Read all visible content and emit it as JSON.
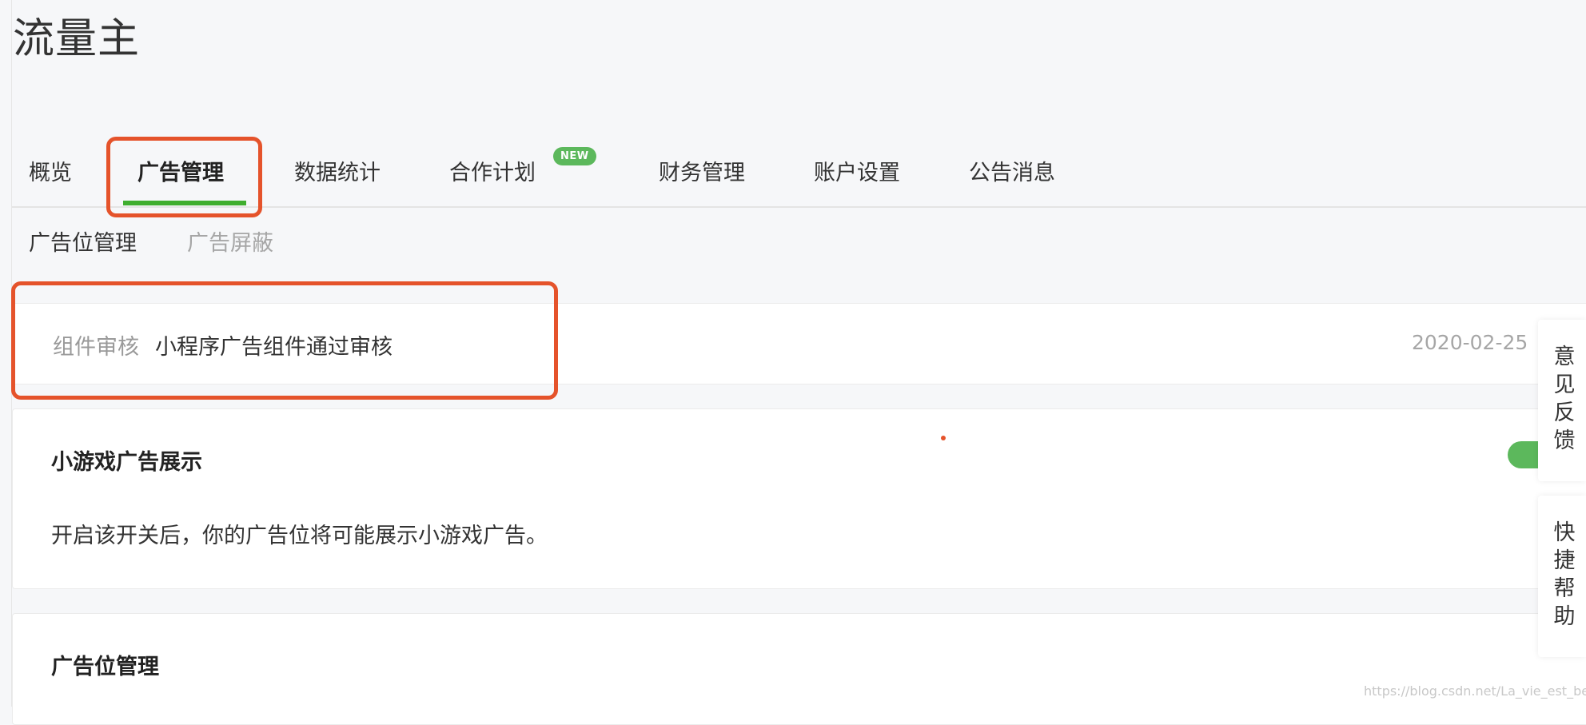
{
  "app": {
    "title": "流量主"
  },
  "nav": {
    "tabs": [
      {
        "label": "概览"
      },
      {
        "label": "广告管理"
      },
      {
        "label": "数据统计"
      },
      {
        "label": "合作计划"
      },
      {
        "label": "财务管理"
      },
      {
        "label": "账户设置"
      },
      {
        "label": "公告消息"
      }
    ],
    "badge": "NEW",
    "active_index": 1
  },
  "subnav": {
    "items": [
      {
        "label": "广告位管理"
      },
      {
        "label": "广告屏蔽"
      }
    ]
  },
  "notice": {
    "type": "组件审核",
    "text": "小程序广告组件通过审核",
    "date": "2020-02-25"
  },
  "game_ads": {
    "title": "小游戏广告展示",
    "description": "开启该开关后，你的广告位将可能展示小游戏广告。",
    "enabled": true
  },
  "ad_slots": {
    "title": "广告位管理"
  },
  "side": {
    "feedback": "意见反馈",
    "help": "快捷帮助"
  },
  "watermark": "https://blog.csdn.net/La_vie_est_belle",
  "colors": {
    "accent_green": "#3fae2f",
    "annotation_red": "#e5532b",
    "badge_green": "#5cb85c",
    "background": "#f6f7f9"
  }
}
